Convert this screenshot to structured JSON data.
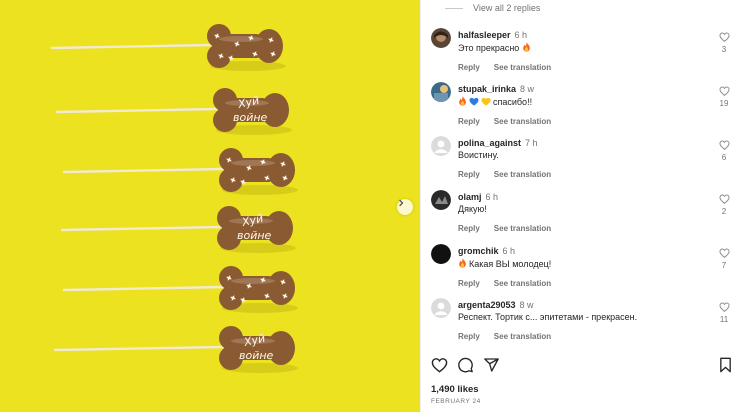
{
  "media": {
    "next_icon": "chevron-right-icon",
    "lollipops": [
      {
        "kind": "dots"
      },
      {
        "kind": "text",
        "text_line1": "Хуй",
        "text_line2": "войне"
      },
      {
        "kind": "dots"
      },
      {
        "kind": "text",
        "text_line1": "Хуй",
        "text_line2": "войне"
      },
      {
        "kind": "dots"
      },
      {
        "kind": "text",
        "text_line1": "Хуй",
        "text_line2": "войне"
      }
    ],
    "colors": {
      "background": "#ece21f",
      "chocolate": "#8a5a32",
      "stick": "#f3ead2"
    }
  },
  "view_replies": "View all 2 replies",
  "comments": [
    {
      "user": "halfasleeper",
      "time": "6 h",
      "text": "Это прекрасно",
      "emoji_before": "",
      "emoji_after": "fire",
      "likes": "3",
      "reply": "Reply",
      "translate": "See translation",
      "avatar_color": "#5a4636"
    },
    {
      "user": "stupak_irinka",
      "time": "8 w",
      "text": "спасибо!!",
      "emoji_before": "fire-blue-heart-yellow-heart",
      "emoji_after": "",
      "likes": "19",
      "reply": "Reply",
      "translate": "See translation",
      "avatar_color": "#3b6a86"
    },
    {
      "user": "polina_against",
      "time": "7 h",
      "text": "Воистину.",
      "emoji_before": "",
      "emoji_after": "",
      "likes": "6",
      "reply": "Reply",
      "translate": "See translation",
      "avatar_color": "#e0e0e0"
    },
    {
      "user": "olamj",
      "time": "6 h",
      "text": "Дякую!",
      "emoji_before": "",
      "emoji_after": "",
      "likes": "2",
      "reply": "Reply",
      "translate": "See translation",
      "avatar_color": "#2a2a2a"
    },
    {
      "user": "gromchik",
      "time": "6 h",
      "text": "Какая ВЫ молодец!",
      "emoji_before": "fire",
      "emoji_after": "",
      "likes": "7",
      "reply": "Reply",
      "translate": "See translation",
      "avatar_color": "#111111"
    },
    {
      "user": "argenta29053",
      "time": "8 w",
      "text": "Респект. Тортик с... эпитетами - прекрасен.",
      "emoji_before": "",
      "emoji_after": "",
      "likes": "11",
      "reply": "Reply",
      "translate": "See translation",
      "avatar_color": "#e0e0e0"
    }
  ],
  "toolbar": {
    "like_icon": "heart-icon",
    "comment_icon": "comment-icon",
    "share_icon": "share-icon",
    "save_icon": "bookmark-icon"
  },
  "likes_text": "1,490 likes",
  "date_text": "FEBRUARY 24"
}
